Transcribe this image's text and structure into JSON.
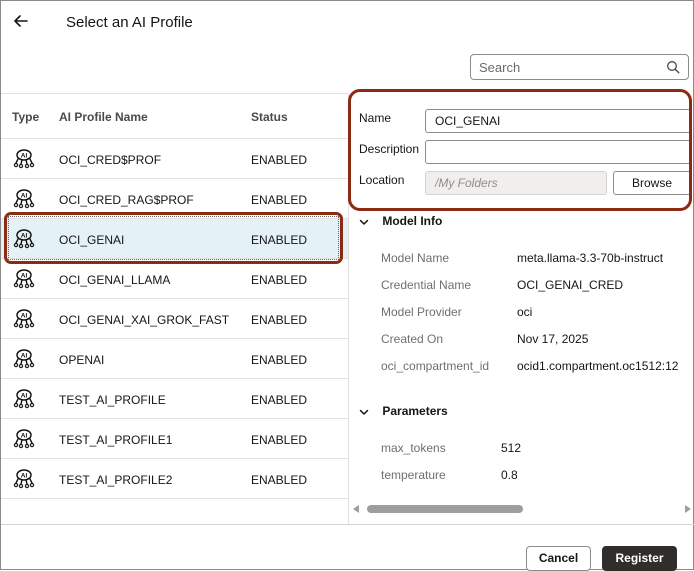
{
  "header": {
    "title": "Select an AI Profile",
    "back_icon": "arrow-left-icon"
  },
  "search": {
    "placeholder": "Search",
    "value": "",
    "icon": "search-icon"
  },
  "table": {
    "columns": [
      "Type",
      "AI Profile Name",
      "Status"
    ],
    "rows": [
      {
        "name": "OCI_CRED$PROF",
        "status": "ENABLED",
        "icon": "ai-profile-icon",
        "selected": false
      },
      {
        "name": "OCI_CRED_RAG$PROF",
        "status": "ENABLED",
        "icon": "ai-profile-icon",
        "selected": false
      },
      {
        "name": "OCI_GENAI",
        "status": "ENABLED",
        "icon": "ai-profile-icon",
        "selected": true
      },
      {
        "name": "OCI_GENAI_LLAMA",
        "status": "ENABLED",
        "icon": "ai-profile-icon",
        "selected": false
      },
      {
        "name": "OCI_GENAI_XAI_GROK_FAST",
        "status": "ENABLED",
        "icon": "ai-profile-icon",
        "selected": false
      },
      {
        "name": "OPENAI",
        "status": "ENABLED",
        "icon": "ai-profile-icon",
        "selected": false
      },
      {
        "name": "TEST_AI_PROFILE",
        "status": "ENABLED",
        "icon": "ai-profile-icon",
        "selected": false
      },
      {
        "name": "TEST_AI_PROFILE1",
        "status": "ENABLED",
        "icon": "ai-profile-icon",
        "selected": false
      },
      {
        "name": "TEST_AI_PROFILE2",
        "status": "ENABLED",
        "icon": "ai-profile-icon",
        "selected": false
      }
    ]
  },
  "form": {
    "name_label": "Name",
    "name_value": "OCI_GENAI",
    "description_label": "Description",
    "description_value": "",
    "location_label": "Location",
    "location_placeholder": "/My Folders",
    "browse_label": "Browse"
  },
  "model_info": {
    "heading": "Model Info",
    "items": [
      {
        "label": "Model Name",
        "value": "meta.llama-3.3-70b-instruct"
      },
      {
        "label": "Credential Name",
        "value": "OCI_GENAI_CRED"
      },
      {
        "label": "Model Provider",
        "value": "oci"
      },
      {
        "label": "Created On",
        "value": "Nov 17, 2025"
      },
      {
        "label": "oci_compartment_id",
        "value": "ocid1.compartment.oc1512:12"
      }
    ]
  },
  "parameters": {
    "heading": "Parameters",
    "items": [
      {
        "label": "max_tokens",
        "value": "512"
      },
      {
        "label": "temperature",
        "value": "0.8"
      }
    ]
  },
  "footer": {
    "cancel_label": "Cancel",
    "register_label": "Register"
  },
  "colors": {
    "highlight": "#8b2b14",
    "selected_row": "#e4f1f7",
    "primary_button": "#312d2a"
  }
}
